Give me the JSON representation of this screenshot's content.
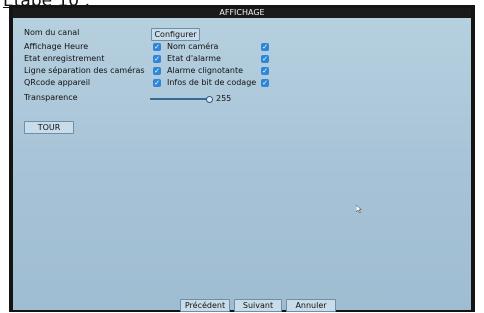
{
  "caption": "Etape 10 :",
  "window": {
    "title": "AFFICHAGE"
  },
  "settings": {
    "channel_name_label": "Nom du canal",
    "configure_button": "Configurer",
    "rows": [
      {
        "left_label": "Affichage Heure",
        "left_checked": true,
        "right_label": "Nom caméra",
        "right_checked": true
      },
      {
        "left_label": "Etat enregistrement",
        "left_checked": true,
        "right_label": "Etat d'alarme",
        "right_checked": true
      },
      {
        "left_label": "Ligne séparation des caméras",
        "left_checked": true,
        "right_label": "Alarme clignotante",
        "right_checked": true
      },
      {
        "left_label": "QRcode appareil",
        "left_checked": true,
        "right_label": "Infos de bit de codage",
        "right_checked": true
      }
    ],
    "transparency_label": "Transparence",
    "transparency_value": "255",
    "tour_button": "TOUR"
  },
  "footer": {
    "previous": "Précédent",
    "next": "Suivant",
    "cancel": "Annuler"
  },
  "colors": {
    "panel": "#a9c5d7",
    "checkbox": "#2f86d9",
    "titlebar": "#1a1a1a"
  }
}
